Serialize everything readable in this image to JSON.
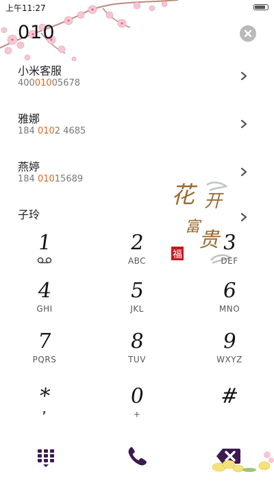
{
  "status_bar": {
    "time": "上午11:27",
    "battery_level": 0.9
  },
  "dialer": {
    "input_value": "010"
  },
  "contacts": [
    {
      "name": "小米客服",
      "number_prefix": "400",
      "number_match": "010",
      "number_suffix": "05678"
    },
    {
      "name": "雅娜",
      "number_prefix": "184 ",
      "number_match": "010",
      "number_suffix": "2 4685"
    },
    {
      "name": "燕婷",
      "number_prefix": "184 ",
      "number_match": "010",
      "number_suffix": "15689"
    },
    {
      "name": "子玲",
      "number_prefix": "",
      "number_match": "",
      "number_suffix": ""
    }
  ],
  "keypad": {
    "keys": [
      {
        "digit": "1",
        "letters": ""
      },
      {
        "digit": "2",
        "letters": "ABC"
      },
      {
        "digit": "3",
        "letters": "DEF"
      },
      {
        "digit": "4",
        "letters": "GHI"
      },
      {
        "digit": "5",
        "letters": "JKL"
      },
      {
        "digit": "6",
        "letters": "MNO"
      },
      {
        "digit": "7",
        "letters": "PQRS"
      },
      {
        "digit": "8",
        "letters": "TUV"
      },
      {
        "digit": "9",
        "letters": "WXYZ"
      },
      {
        "digit": "*",
        "letters": ","
      },
      {
        "digit": "0",
        "letters": "+"
      },
      {
        "digit": "#",
        "letters": ""
      }
    ]
  },
  "decoration": {
    "calligraphy_text": "花开富贵",
    "seal_text": "福"
  },
  "icons": {
    "clear": "clear-icon",
    "chevron": "chevron-right-icon",
    "voicemail": "voicemail-icon",
    "keypad_toggle": "dialpad-icon",
    "call": "phone-icon",
    "delete": "backspace-icon"
  },
  "colors": {
    "accent": "#3d1a4f",
    "highlight": "#e0661c",
    "seal_red": "#c8161d"
  }
}
